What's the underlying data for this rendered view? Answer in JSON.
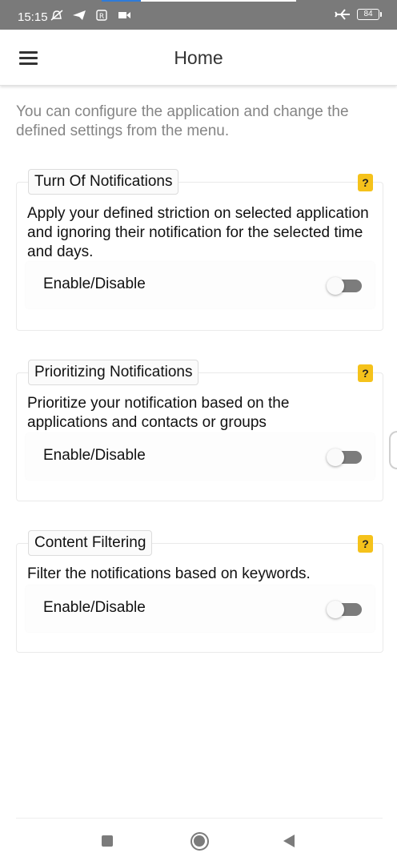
{
  "status_bar": {
    "time": "15:15",
    "icons": [
      "muted-notifications-icon",
      "telegram-icon",
      "r-app-icon",
      "video-icon"
    ],
    "right_icons": [
      "airplane-mode-icon"
    ],
    "battery": "84",
    "progress_fraction": 0.2
  },
  "app_bar": {
    "title": "Home",
    "menu_icon": "hamburger-menu-icon"
  },
  "intro": "You can configure the application and change the defined settings from the menu.",
  "cards": [
    {
      "title": "Turn Of Notifications",
      "help": "?",
      "description": "Apply your defined striction on selected application and ignoring their notification for the selected time and days.",
      "toggle_label": "Enable/Disable",
      "enabled": false
    },
    {
      "title": "Prioritizing Notifications",
      "help": "?",
      "description": "Prioritize your notification based on the applications and contacts or groups",
      "toggle_label": "Enable/Disable",
      "enabled": false
    },
    {
      "title": "Content Filtering",
      "help": "?",
      "description": "Filter the notifications based on keywords.",
      "toggle_label": "Enable/Disable",
      "enabled": false
    }
  ],
  "nav_bar": {
    "icons": [
      "recents-square-icon",
      "home-circle-icon",
      "back-triangle-icon"
    ]
  },
  "colors": {
    "status_bar": "#7a7a7a",
    "help_badge": "#f5c21b",
    "switch_track_off": "#7c7c7c",
    "intro_text": "#858585"
  }
}
